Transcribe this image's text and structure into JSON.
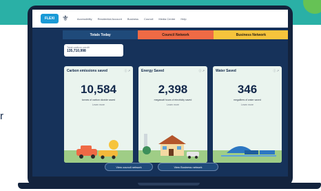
{
  "side_text": "r",
  "nav": {
    "logo_text": "FLEXI",
    "menu_items": [
      "Accessibility",
      "Residential Account",
      "Business",
      "Council",
      "Media Centre",
      "Help"
    ]
  },
  "tabs": [
    "Totals Today",
    "Council Network",
    "Business Network"
  ],
  "counter": {
    "label": "Total carbon credit",
    "value": "135,710,998"
  },
  "cards": [
    {
      "title": "Carbon emissions saved",
      "value": "10,584",
      "description": "tonnes of carbon dioxide saved",
      "link": "Learn more"
    },
    {
      "title": "Energy Saved",
      "value": "2,398",
      "description": "megawatt hours of electricity saved",
      "link": "Learn more"
    },
    {
      "title": "Water Saved",
      "value": "346",
      "description": "megalitres of water saved",
      "link": "Learn more"
    }
  ],
  "buttons": [
    "View council network",
    "View Business network"
  ],
  "colors": {
    "teal": "#2ab0a6",
    "navy": "#16325a",
    "orange": "#ef6a45",
    "yellow": "#f6c43c"
  }
}
